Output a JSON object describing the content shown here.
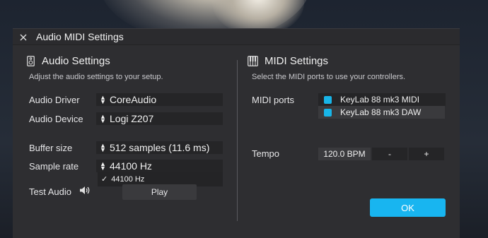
{
  "window": {
    "title": "Audio MIDI Settings"
  },
  "audio": {
    "title": "Audio Settings",
    "description": "Adjust the audio settings to your setup.",
    "driver_label": "Audio Driver",
    "driver_value": "CoreAudio",
    "device_label": "Audio Device",
    "device_value": "Logi Z207",
    "buffer_label": "Buffer size",
    "buffer_value": "512 samples (11.6 ms)",
    "samplerate_label": "Sample rate",
    "samplerate_value": "44100 Hz",
    "samplerate_options": [
      "44100 Hz"
    ],
    "test_label": "Test Audio",
    "play_label": "Play"
  },
  "midi": {
    "title": "MIDI Settings",
    "description": "Select the MIDI ports to use your controllers.",
    "ports_label": "MIDI ports",
    "ports": [
      "KeyLab 88 mk3 MIDI",
      "KeyLab 88 mk3 DAW"
    ],
    "tempo_label": "Tempo",
    "tempo_value": "120.0 BPM",
    "minus_label": "-",
    "plus_label": "+"
  },
  "ok_label": "OK",
  "colors": {
    "accent": "#18b5f0",
    "panel": "#2e2e31",
    "field": "#252527"
  }
}
